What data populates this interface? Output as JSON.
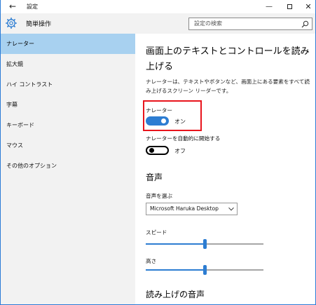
{
  "window": {
    "title": "設定",
    "back_glyph": "←",
    "min_glyph": "—",
    "close_glyph": "✕"
  },
  "sidebar": {
    "title": "簡単操作",
    "items": [
      {
        "label": "ナレーター",
        "active": true
      },
      {
        "label": "拡大鏡",
        "active": false
      },
      {
        "label": "ハイ コントラスト",
        "active": false
      },
      {
        "label": "字幕",
        "active": false
      },
      {
        "label": "キーボード",
        "active": false
      },
      {
        "label": "マウス",
        "active": false
      },
      {
        "label": "その他のオプション",
        "active": false
      }
    ]
  },
  "search": {
    "placeholder": "設定の検索"
  },
  "main": {
    "heading": "画面上のテキストとコントロールを読み上げる",
    "description": "ナレーターは、テキストやボタンなど、画面上にある要素をすべて読み上げるスクリーン リーダーです。",
    "narrator_toggle": {
      "label": "ナレーター",
      "state_text": "オン",
      "on": true
    },
    "autostart_toggle": {
      "label": "ナレーターを自動的に開始する",
      "state_text": "オフ",
      "on": false
    },
    "voice_section_title": "音声",
    "voice_select_label": "音声を選ぶ",
    "voice_select_value": "Microsoft Haruka Desktop",
    "speed_label": "スピード",
    "speed_value": 0.5,
    "pitch_label": "高さ",
    "pitch_value": 0.5,
    "next_section_title": "読み上げの音声"
  },
  "colors": {
    "accent": "#2d7dd2",
    "highlight_box": "#e8141c",
    "sidebar_bg": "#f2f2f2",
    "active_item_bg": "#a8d1f0"
  }
}
